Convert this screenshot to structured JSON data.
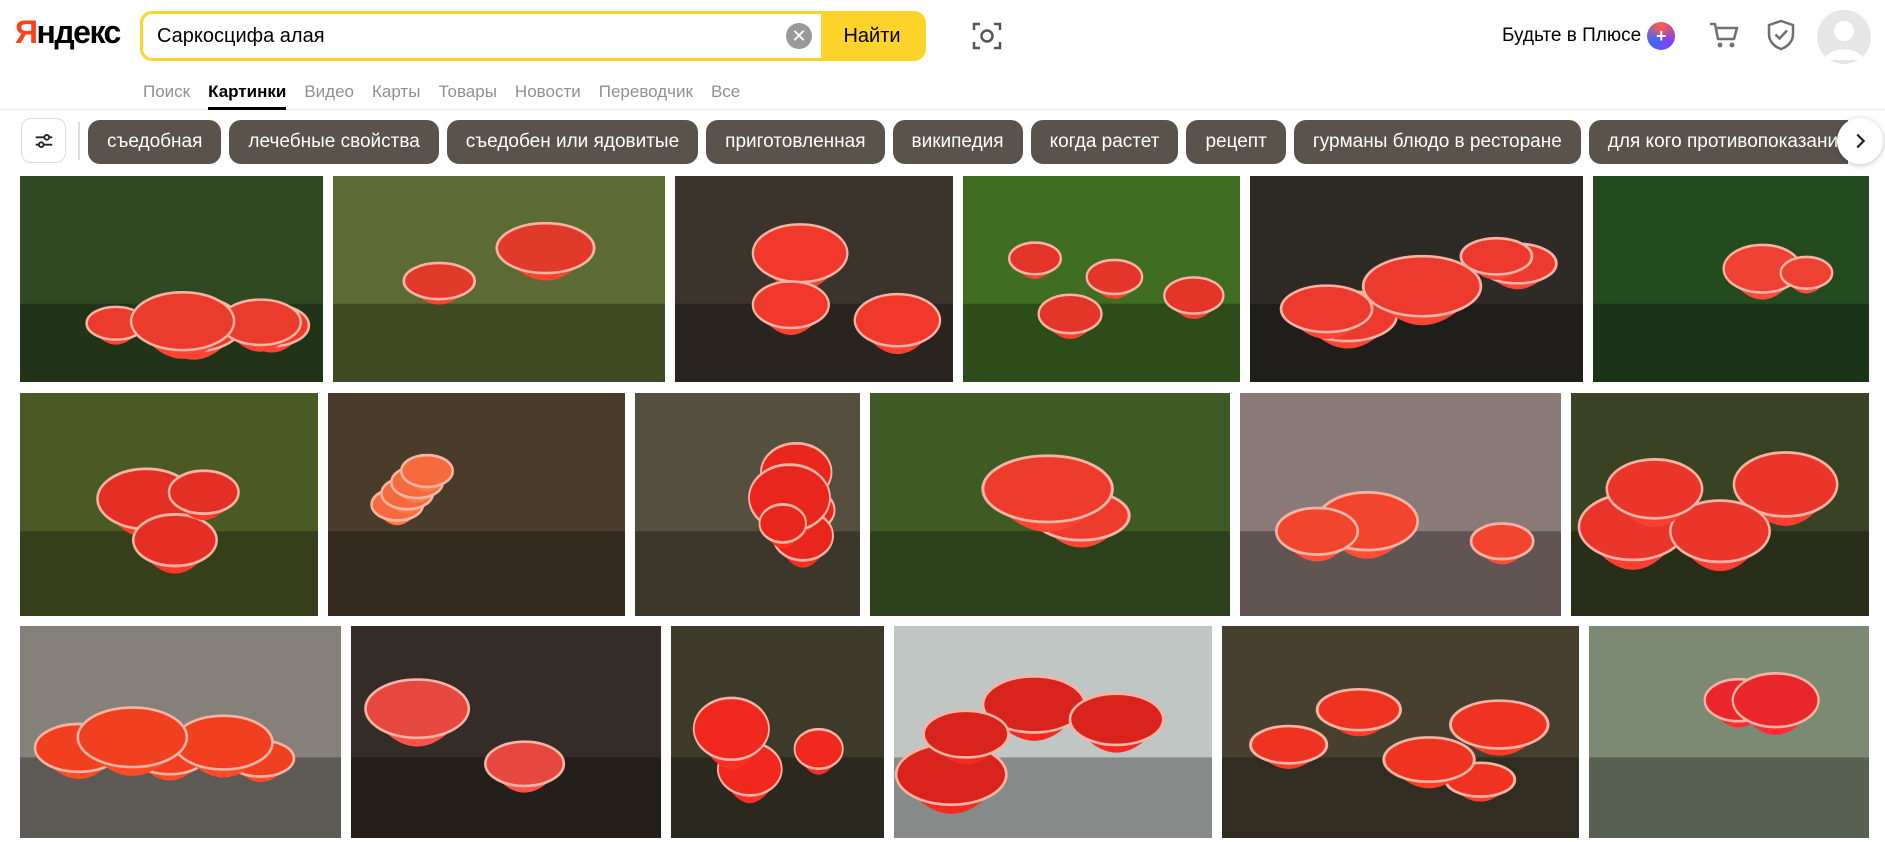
{
  "logo": {
    "first_letter": "Я",
    "rest": "ндекс"
  },
  "search": {
    "query": "Саркосцифа алая",
    "find_label": "Найти"
  },
  "header": {
    "plus_label": "Будьте в Плюсе"
  },
  "icons": {
    "lens": "camera-search-icon",
    "cart": "cart-icon",
    "shield": "shield-icon",
    "avatar": "user-avatar-icon",
    "filter": "filter-sliders-icon",
    "chips_next": "chevron-right-icon",
    "clear": "clear-icon"
  },
  "services": [
    {
      "label": "Поиск"
    },
    {
      "label": "Картинки",
      "active": true
    },
    {
      "label": "Видео"
    },
    {
      "label": "Карты"
    },
    {
      "label": "Товары"
    },
    {
      "label": "Новости"
    },
    {
      "label": "Переводчик"
    },
    {
      "label": "Все"
    }
  ],
  "chips": [
    {
      "label": "съедобная"
    },
    {
      "label": "лечебные свойства"
    },
    {
      "label": "съедобен или ядовитые"
    },
    {
      "label": "приготовленная"
    },
    {
      "label": "википедия"
    },
    {
      "label": "когда растет"
    },
    {
      "label": "рецепт"
    },
    {
      "label": "гурманы блюдо в ресторане"
    },
    {
      "label": "для кого противопоказания"
    }
  ],
  "colors": {
    "accent_yellow": "#fed42b",
    "logo_red": "#fc3f1d",
    "chip_bg": "#5a534b",
    "muted_text": "#909090"
  },
  "results": [
    {
      "bg": "#2f4a22",
      "cup": "#ea3b2c"
    },
    {
      "bg": "#5b6b33",
      "cup": "#e23a2a"
    },
    {
      "bg": "#3b342c",
      "cup": "#f0392a"
    },
    {
      "bg": "#3f6e23",
      "cup": "#e4352a"
    },
    {
      "bg": "#2e2b27",
      "cup": "#ec3b2e"
    },
    {
      "bg": "#244a1f",
      "cup": "#ee4133"
    },
    {
      "bg": "#4b5a25",
      "cup": "#e43024"
    },
    {
      "bg": "#4a3c2b",
      "cup": "#f56a3c"
    },
    {
      "bg": "#55503e",
      "cup": "#e8261c"
    },
    {
      "bg": "#3e5b26",
      "cup": "#ed3c2c"
    },
    {
      "bg": "#8a7a77",
      "cup": "#f2452e"
    },
    {
      "bg": "#3a4224",
      "cup": "#e9352a"
    },
    {
      "bg": "#85817a",
      "cup": "#f0401f"
    },
    {
      "bg": "#332c27",
      "cup": "#e6473f"
    },
    {
      "bg": "#3e3a2a",
      "cup": "#f1281e"
    },
    {
      "bg": "#bfc6c3",
      "cup": "#d8241d"
    },
    {
      "bg": "#48402f",
      "cup": "#ee3421"
    },
    {
      "bg": "#7d8a73",
      "cup": "#e9262c"
    }
  ]
}
